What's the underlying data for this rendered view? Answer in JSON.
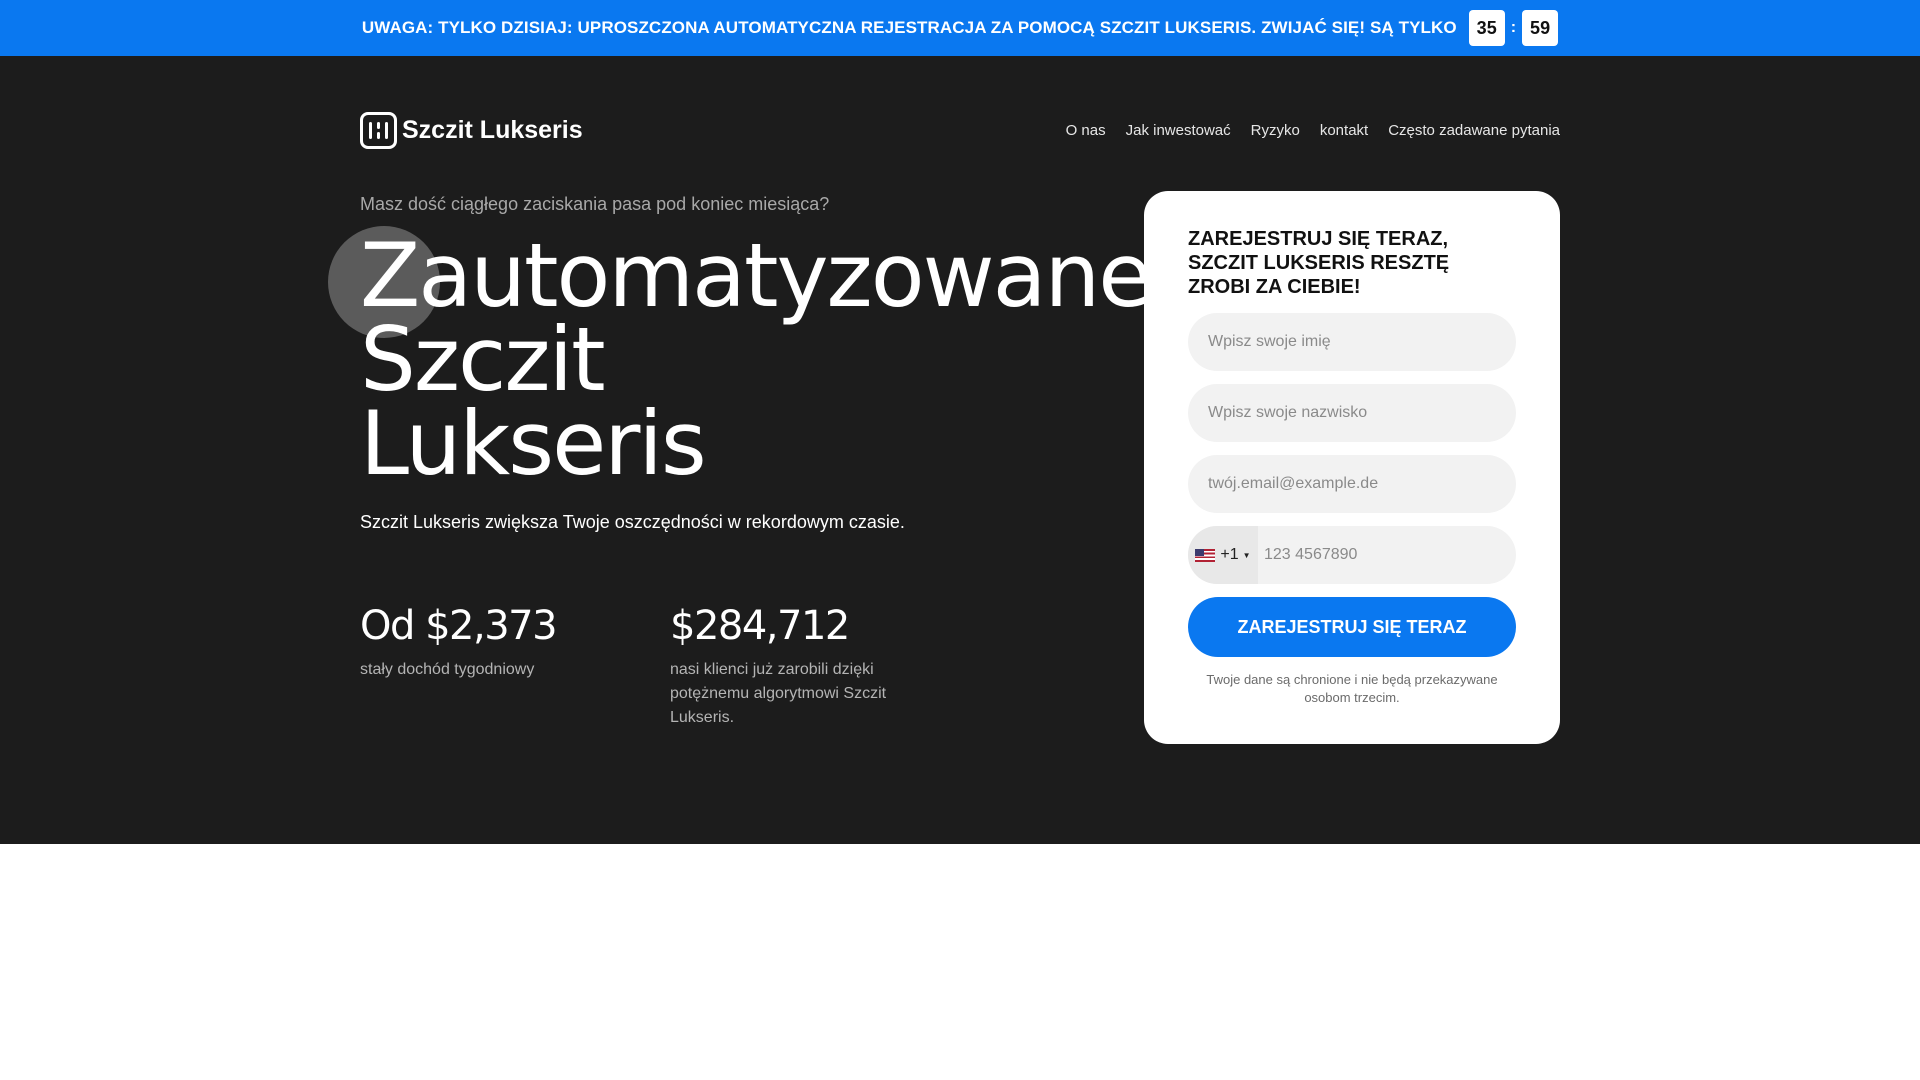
{
  "banner": {
    "text": "UWAGA: TYLKO DZISIAJ: UPROSZCZONA AUTOMATYCZNA REJESTRACJA ZA POMOCĄ SZCZIT LUKSERIS. ZWIJAĆ SIĘ! SĄ TYLKO",
    "minutes": "35",
    "separator": ":",
    "seconds": "59"
  },
  "header": {
    "logo_text": "Szczit Lukseris",
    "nav": [
      "O nas",
      "Jak inwestować",
      "Ryzyko",
      "kontakt",
      "Często zadawane pytania"
    ]
  },
  "hero": {
    "pretitle": "Masz dość ciągłego zaciskania pasa pod koniec miesiąca?",
    "headline": [
      "Zautomatyzowane",
      "Szczit",
      "Lukseris"
    ],
    "subtitle": "Szczit Lukseris zwiększa Twoje oszczędności w rekordowym czasie.",
    "stats": [
      {
        "value": "Od $2,373",
        "label": "stały dochód tygodniowy"
      },
      {
        "value": "$284,712",
        "label": "nasi klienci już zarobili dzięki potężnemu algorytmowi Szczit Lukseris."
      }
    ]
  },
  "form": {
    "title": "ZAREJESTRUJ SIĘ TERAZ, SZCZIT LUKSERIS RESZTĘ ZROBI ZA CIEBIE!",
    "first_name_placeholder": "Wpisz swoje imię",
    "last_name_placeholder": "Wpisz swoje nazwisko",
    "email_placeholder": "twój.email@example.de",
    "country_code": "+1",
    "phone_placeholder": "123 4567890",
    "submit_label": "ZAREJESTRUJ SIĘ TERAZ",
    "privacy_note": "Twoje dane są chronione i nie będą przekazywane osobom trzecim."
  },
  "colors": {
    "accent": "#0a78f0",
    "hero_background": "#1c1c1c"
  },
  "icons": {
    "logo": "logo-icon",
    "flag": "us-flag-icon",
    "caret": "caret-down-icon"
  }
}
